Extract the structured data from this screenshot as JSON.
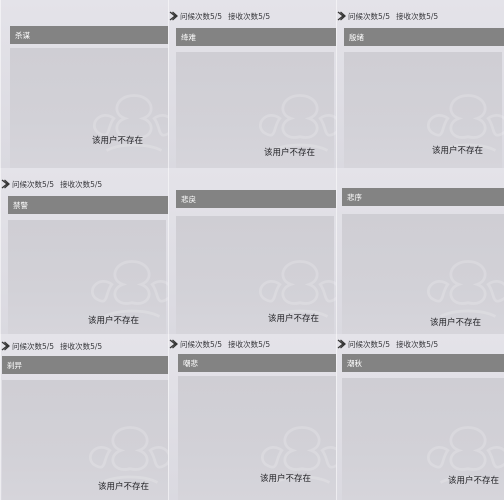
{
  "status_line": {
    "greeting_label": "问候次数",
    "greeting_count": "5/5",
    "receive_label": "接收次数",
    "receive_count": "5/5"
  },
  "error_message": "该用户不存在",
  "cells": [
    {
      "name": "杀谋",
      "show_status": false
    },
    {
      "name": "绛难",
      "show_status": true
    },
    {
      "name": "殷绪",
      "show_status": true
    },
    {
      "name": "禁警",
      "show_status": true
    },
    {
      "name": "悲戾",
      "show_status": false
    },
    {
      "name": "悲序",
      "show_status": false
    },
    {
      "name": "刹异",
      "show_status": true
    },
    {
      "name": "嘲悲",
      "show_status": true
    },
    {
      "name": "潮秋",
      "show_status": true
    }
  ],
  "colors": {
    "name_bar": "#838383",
    "background": "#d9d7df",
    "panel": "#d0cfd5"
  }
}
